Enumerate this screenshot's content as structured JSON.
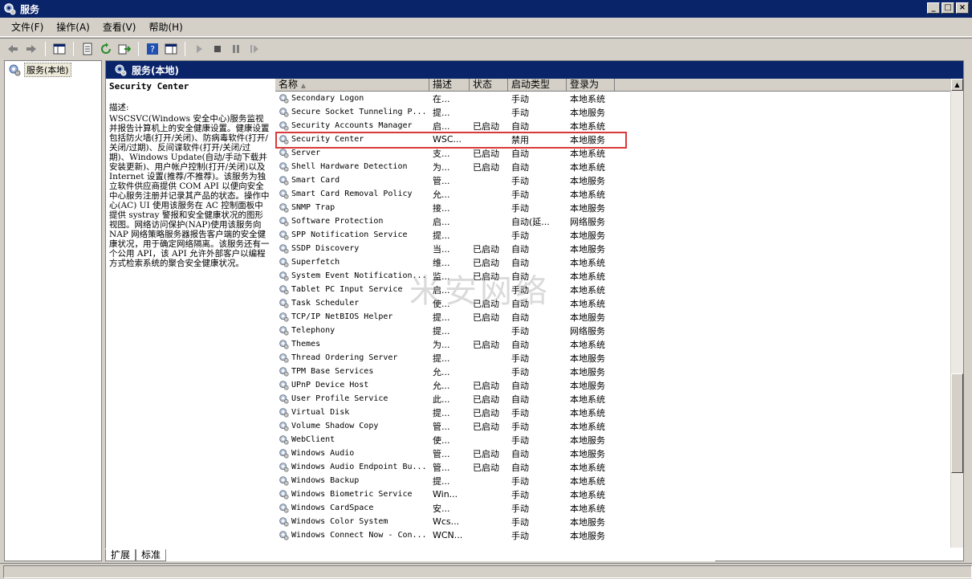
{
  "window": {
    "title": "服务"
  },
  "menu": [
    {
      "label": "文件(F)"
    },
    {
      "label": "操作(A)"
    },
    {
      "label": "查看(V)"
    },
    {
      "label": "帮助(H)"
    }
  ],
  "tree": {
    "root_label": "服务(本地)"
  },
  "panel": {
    "header": "服务(本地)"
  },
  "description": {
    "service_name": "Security Center",
    "label": "描述:",
    "text": "WSCSVC(Windows 安全中心)服务监视并报告计算机上的安全健康设置。健康设置包括防火墙(打开/关闭)、防病毒软件(打开/关闭/过期)、反间谍软件(打开/关闭/过期)、Windows Update(自动/手动下载并安装更新)、用户帐户控制(打开/关闭)以及 Internet 设置(推荐/不推荐)。该服务为独立软件供应商提供 COM API 以便向安全中心服务注册并记录其产品的状态。操作中心(AC) UI 使用该服务在 AC 控制面板中提供 systray 警报和安全健康状况的图形视图。网络访问保护(NAP)使用该服务向 NAP 网络策略服务器报告客户端的安全健康状况，用于确定网络隔离。该服务还有一个公用 API，该 API 允许外部客户以编程方式检索系统的聚合安全健康状况。"
  },
  "columns": {
    "name": "名称",
    "desc": "描述",
    "status": "状态",
    "start": "启动类型",
    "logon": "登录为"
  },
  "services": [
    {
      "name": "Secondary Logon",
      "desc": "在...",
      "status": "",
      "start": "手动",
      "logon": "本地系统"
    },
    {
      "name": "Secure Socket Tunneling P...",
      "desc": "提...",
      "status": "",
      "start": "手动",
      "logon": "本地服务"
    },
    {
      "name": "Security Accounts Manager",
      "desc": "启...",
      "status": "已启动",
      "start": "自动",
      "logon": "本地系统"
    },
    {
      "name": "Security Center",
      "desc": "WSC...",
      "status": "",
      "start": "禁用",
      "logon": "本地服务"
    },
    {
      "name": "Server",
      "desc": "支...",
      "status": "已启动",
      "start": "自动",
      "logon": "本地系统"
    },
    {
      "name": "Shell Hardware Detection",
      "desc": "为...",
      "status": "已启动",
      "start": "自动",
      "logon": "本地系统"
    },
    {
      "name": "Smart Card",
      "desc": "管...",
      "status": "",
      "start": "手动",
      "logon": "本地服务"
    },
    {
      "name": "Smart Card Removal Policy",
      "desc": "允...",
      "status": "",
      "start": "手动",
      "logon": "本地系统"
    },
    {
      "name": "SNMP Trap",
      "desc": "接...",
      "status": "",
      "start": "手动",
      "logon": "本地服务"
    },
    {
      "name": "Software Protection",
      "desc": "启...",
      "status": "",
      "start": "自动(延...",
      "logon": "网络服务"
    },
    {
      "name": "SPP Notification Service",
      "desc": "提...",
      "status": "",
      "start": "手动",
      "logon": "本地服务"
    },
    {
      "name": "SSDP Discovery",
      "desc": "当...",
      "status": "已启动",
      "start": "自动",
      "logon": "本地服务"
    },
    {
      "name": "Superfetch",
      "desc": "维...",
      "status": "已启动",
      "start": "自动",
      "logon": "本地系统"
    },
    {
      "name": "System Event Notification...",
      "desc": "监...",
      "status": "已启动",
      "start": "自动",
      "logon": "本地系统"
    },
    {
      "name": "Tablet PC Input Service",
      "desc": "启...",
      "status": "",
      "start": "手动",
      "logon": "本地系统"
    },
    {
      "name": "Task Scheduler",
      "desc": "使...",
      "status": "已启动",
      "start": "自动",
      "logon": "本地系统"
    },
    {
      "name": "TCP/IP NetBIOS Helper",
      "desc": "提...",
      "status": "已启动",
      "start": "自动",
      "logon": "本地服务"
    },
    {
      "name": "Telephony",
      "desc": "提...",
      "status": "",
      "start": "手动",
      "logon": "网络服务"
    },
    {
      "name": "Themes",
      "desc": "为...",
      "status": "已启动",
      "start": "自动",
      "logon": "本地系统"
    },
    {
      "name": "Thread Ordering Server",
      "desc": "提...",
      "status": "",
      "start": "手动",
      "logon": "本地服务"
    },
    {
      "name": "TPM Base Services",
      "desc": "允...",
      "status": "",
      "start": "手动",
      "logon": "本地服务"
    },
    {
      "name": "UPnP Device Host",
      "desc": "允...",
      "status": "已启动",
      "start": "自动",
      "logon": "本地服务"
    },
    {
      "name": "User Profile Service",
      "desc": "此...",
      "status": "已启动",
      "start": "自动",
      "logon": "本地系统"
    },
    {
      "name": "Virtual Disk",
      "desc": "提...",
      "status": "已启动",
      "start": "手动",
      "logon": "本地系统"
    },
    {
      "name": "Volume Shadow Copy",
      "desc": "管...",
      "status": "已启动",
      "start": "手动",
      "logon": "本地系统"
    },
    {
      "name": "WebClient",
      "desc": "使...",
      "status": "",
      "start": "手动",
      "logon": "本地服务"
    },
    {
      "name": "Windows Audio",
      "desc": "管...",
      "status": "已启动",
      "start": "自动",
      "logon": "本地服务"
    },
    {
      "name": "Windows Audio Endpoint Bu...",
      "desc": "管...",
      "status": "已启动",
      "start": "自动",
      "logon": "本地系统"
    },
    {
      "name": "Windows Backup",
      "desc": "提...",
      "status": "",
      "start": "手动",
      "logon": "本地系统"
    },
    {
      "name": "Windows Biometric Service",
      "desc": "Win...",
      "status": "",
      "start": "手动",
      "logon": "本地系统"
    },
    {
      "name": "Windows CardSpace",
      "desc": "安...",
      "status": "",
      "start": "手动",
      "logon": "本地系统"
    },
    {
      "name": "Windows Color System",
      "desc": "Wcs...",
      "status": "",
      "start": "手动",
      "logon": "本地服务"
    },
    {
      "name": "Windows Connect Now - Con...",
      "desc": "WCN...",
      "status": "",
      "start": "手动",
      "logon": "本地服务"
    }
  ],
  "tabs": [
    {
      "label": "扩展"
    },
    {
      "label": "标准"
    }
  ],
  "watermark": "米安网络",
  "colors": {
    "titlebar": "#0a246a",
    "highlight_box": "#d9393a",
    "chrome": "#d4d0c8"
  }
}
